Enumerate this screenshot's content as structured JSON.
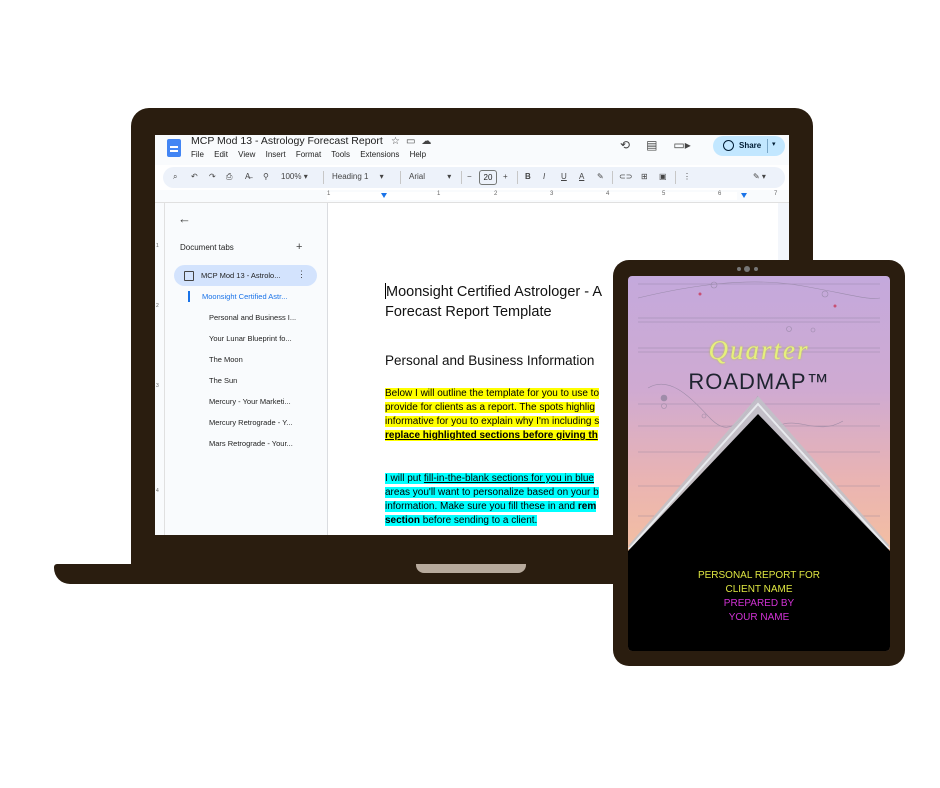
{
  "docs": {
    "title": "MCP Mod 13 - Astrology Forecast Report",
    "menu": [
      "File",
      "Edit",
      "View",
      "Insert",
      "Format",
      "Tools",
      "Extensions",
      "Help"
    ],
    "share_label": "Share",
    "toolbar": {
      "zoom": "100%",
      "style": "Heading 1",
      "font": "Arial",
      "font_size": "20"
    },
    "ruler_numbers": [
      "1",
      "1",
      "2",
      "3",
      "4",
      "5",
      "6",
      "7"
    ],
    "vruler_numbers": [
      "1",
      "2",
      "3",
      "4"
    ],
    "sidebar": {
      "heading": "Document tabs",
      "active_tab": "MCP Mod 13 - Astrolo...",
      "items": [
        "Moonsight Certified Astr...",
        "Personal and Business I...",
        "Your Lunar Blueprint fo...",
        "The Moon",
        "The Sun",
        "Mercury - Your Marketi...",
        "Mercury Retrograde - Y...",
        "Mars Retrograde - Your..."
      ]
    },
    "document": {
      "title_line1": "Moonsight Certified Astrologer - A",
      "title_line2": "Forecast Report Template",
      "section_heading": "Personal and Business Information",
      "p1_line1": "Below I will outline the template for you to use to",
      "p1_line2": "provide for clients as a report. The spots highlig",
      "p1_line3": "informative for you to explain why I'm including s",
      "p1_line4": "replace highlighted sections before giving th",
      "p2_line1_pre": "I will put ",
      "p2_line1_link": "fill-in-the-blank sections for you in blue",
      "p2_line2": "areas you'll want to personalize based on your b",
      "p2_line3_pre": "information. Make sure you fill these in and ",
      "p2_line3_bold": "rem",
      "p2_line4_bold": "section",
      "p2_line4_rest": " before sending to a client."
    }
  },
  "cover": {
    "title_script": "Quarter",
    "title_main": "ROADMAP™",
    "line1": "PERSONAL REPORT FOR",
    "line2": "CLIENT NAME",
    "line3": "PREPARED BY",
    "line4": "YOUR NAME",
    "colors": {
      "script": "#e6f07c",
      "yellow_text": "#dfe641",
      "magenta_text": "#d232d6",
      "device_frame": "#2a1d0f",
      "docs_accent": "#1a73e8"
    }
  }
}
